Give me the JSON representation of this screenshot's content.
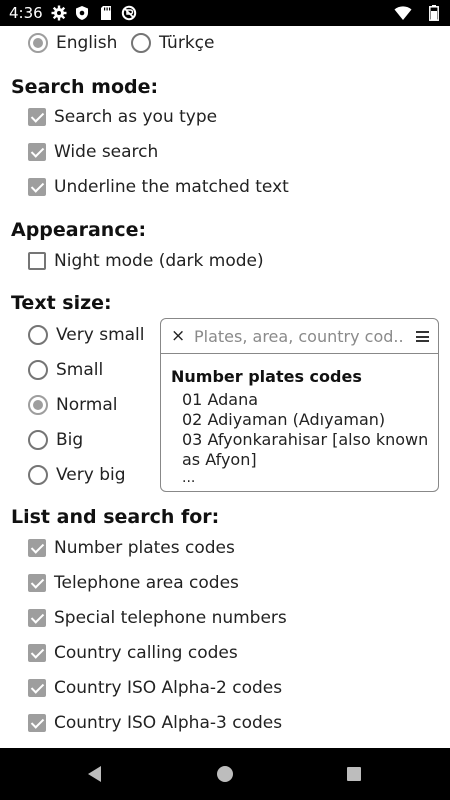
{
  "status_bar": {
    "time": "4:36",
    "icons": [
      "gear-icon",
      "shield-icon",
      "sd-card-icon",
      "no-data-icon",
      "wifi-icon",
      "battery-icon"
    ]
  },
  "language": {
    "options": [
      {
        "label": "English",
        "selected": true
      },
      {
        "label": "Türkçe",
        "selected": false
      }
    ]
  },
  "search_mode": {
    "heading": "Search mode:",
    "options": [
      {
        "label": "Search as you type",
        "checked": true
      },
      {
        "label": "Wide search",
        "checked": true
      },
      {
        "label": "Underline the matched text",
        "checked": true
      }
    ]
  },
  "appearance": {
    "heading": "Appearance:",
    "options": [
      {
        "label": "Night mode (dark mode)",
        "checked": false
      }
    ]
  },
  "text_size": {
    "heading": "Text size:",
    "options": [
      {
        "label": "Very small",
        "selected": false
      },
      {
        "label": "Small",
        "selected": false
      },
      {
        "label": "Normal",
        "selected": true
      },
      {
        "label": "Big",
        "selected": false
      },
      {
        "label": "Very big",
        "selected": false
      }
    ]
  },
  "preview": {
    "close_glyph": "×",
    "search_placeholder": "Plates, area, country cod...",
    "list_title": "Number plates codes",
    "items": [
      "01 Adana",
      "02 Adiyaman (Adıyaman)",
      "03 Afyonkarahisar [also known as Afyon]",
      "..."
    ]
  },
  "list_search_for": {
    "heading": "List and search for:",
    "options": [
      {
        "label": "Number plates codes",
        "checked": true
      },
      {
        "label": "Telephone area codes",
        "checked": true
      },
      {
        "label": "Special telephone numbers",
        "checked": true
      },
      {
        "label": "Country calling codes",
        "checked": true
      },
      {
        "label": "Country ISO Alpha-2 codes",
        "checked": true
      },
      {
        "label": "Country ISO Alpha-3 codes",
        "checked": true
      }
    ]
  },
  "colors": {
    "control_checked": "#9e9e9e",
    "control_unchecked": "#757575",
    "status_bar": "#000000",
    "nav_bar": "#000000"
  }
}
